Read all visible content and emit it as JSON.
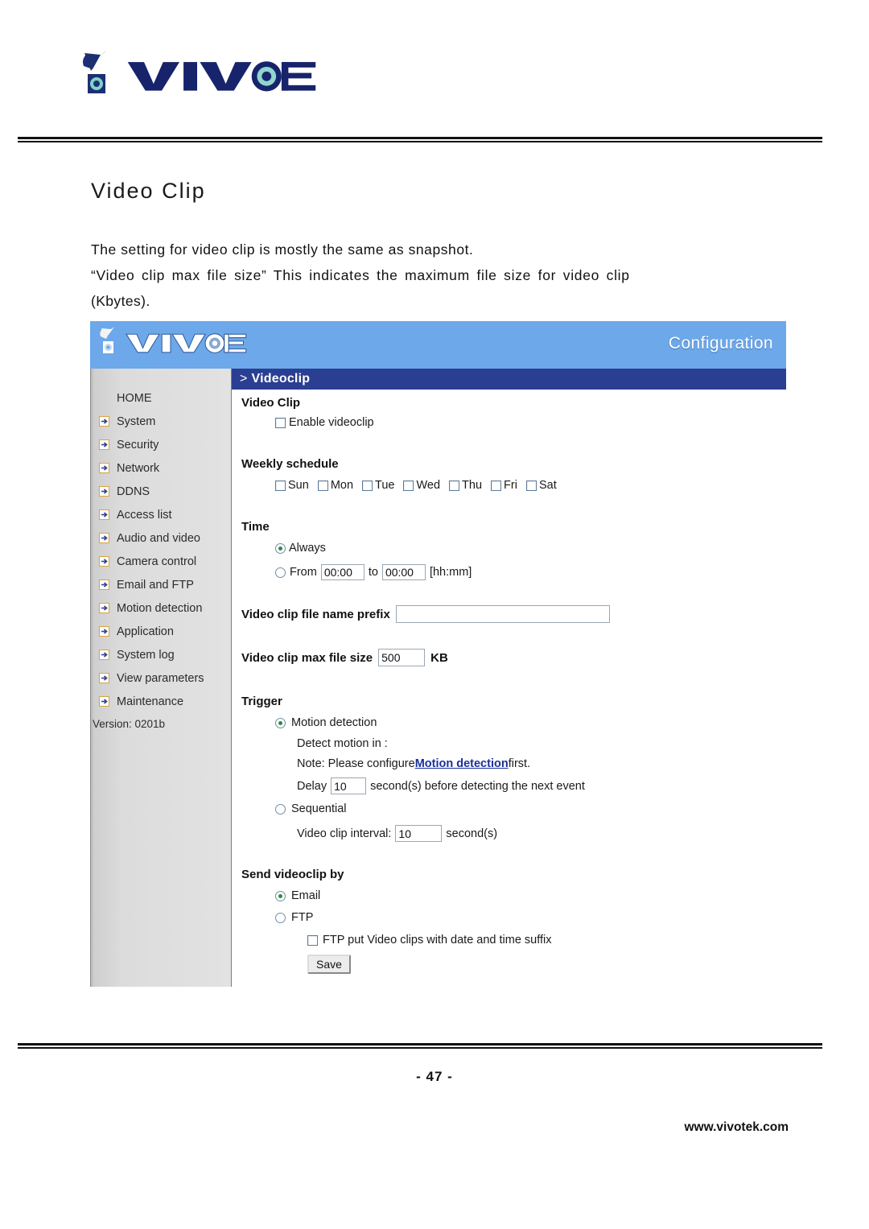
{
  "document": {
    "brand": "VIVOTEK",
    "title": "Video Clip",
    "paragraph_line1": "The setting for video clip is mostly the same as snapshot.",
    "paragraph_line2": "“Video clip max file size” This indicates the maximum file size for video clip",
    "paragraph_line3": "(Kbytes).",
    "page_number": "- 47 -",
    "website": "www.vivotek.com"
  },
  "screenshot": {
    "banner": {
      "brand": "VIVOTEK",
      "mode_label": "Configuration",
      "bg_color": "#6ca8ea"
    },
    "breadcrumb": {
      "prefix": ">",
      "label": "Videoclip",
      "bg_color": "#2b3f92"
    },
    "sidebar": {
      "items": [
        {
          "label": "HOME",
          "has_bullet": false
        },
        {
          "label": "System",
          "has_bullet": true
        },
        {
          "label": "Security",
          "has_bullet": true
        },
        {
          "label": "Network",
          "has_bullet": true
        },
        {
          "label": "DDNS",
          "has_bullet": true
        },
        {
          "label": "Access list",
          "has_bullet": true
        },
        {
          "label": "Audio and video",
          "has_bullet": true
        },
        {
          "label": "Camera control",
          "has_bullet": true
        },
        {
          "label": "Email and FTP",
          "has_bullet": true
        },
        {
          "label": "Motion detection",
          "has_bullet": true
        },
        {
          "label": "Application",
          "has_bullet": true
        },
        {
          "label": "System log",
          "has_bullet": true
        },
        {
          "label": "View parameters",
          "has_bullet": true
        },
        {
          "label": "Maintenance",
          "has_bullet": true
        }
      ],
      "version": "Version: 0201b"
    },
    "form": {
      "videoclip_heading": "Video Clip",
      "enable_label": "Enable videoclip",
      "enable_checked": false,
      "weekly_heading": "Weekly schedule",
      "days": [
        {
          "label": "Sun",
          "checked": false
        },
        {
          "label": "Mon",
          "checked": false
        },
        {
          "label": "Tue",
          "checked": false
        },
        {
          "label": "Wed",
          "checked": false
        },
        {
          "label": "Thu",
          "checked": false
        },
        {
          "label": "Fri",
          "checked": false
        },
        {
          "label": "Sat",
          "checked": false
        }
      ],
      "time_heading": "Time",
      "always_label": "Always",
      "always_selected": true,
      "from_label": "From",
      "from_value": "00:00",
      "to_label": "to",
      "to_value": "00:00",
      "hhmm_label": "[hh:mm]",
      "from_selected": false,
      "prefix_label": "Video clip file name prefix",
      "prefix_value": "",
      "maxsize_label": "Video clip max file size",
      "maxsize_value": "500",
      "maxsize_unit": "KB",
      "trigger_heading": "Trigger",
      "motion_label": "Motion detection",
      "motion_selected": true,
      "detect_motion_in_label": "Detect motion in :",
      "note_prefix": "Note: Please configure ",
      "note_link": "Motion detection",
      "note_suffix": " first.",
      "delay_label": "Delay",
      "delay_value": "10",
      "delay_suffix": "second(s) before detecting the next event",
      "sequential_label": "Sequential",
      "sequential_selected": false,
      "interval_label": "Video clip interval:",
      "interval_value": "10",
      "interval_unit": "second(s)",
      "send_heading": "Send videoclip by",
      "email_label": "Email",
      "email_selected": true,
      "ftp_label": "FTP",
      "ftp_selected": false,
      "ftp_suffix_label": "FTP put Video clips with date and time suffix",
      "ftp_suffix_checked": false,
      "save_label": "Save"
    }
  }
}
